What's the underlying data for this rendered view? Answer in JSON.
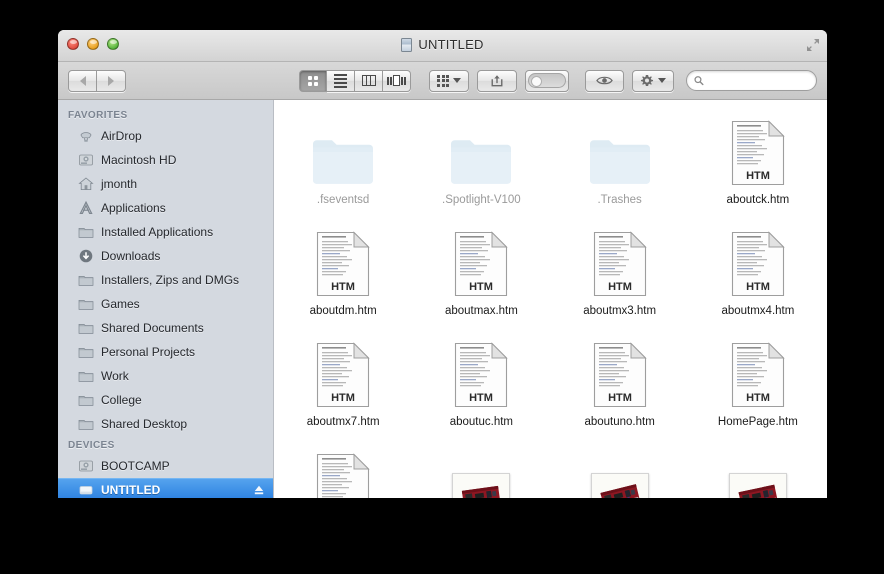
{
  "window": {
    "title": "UNTITLED",
    "title_icon": "drive-icon",
    "controls": {
      "close": "close-button",
      "minimize": "minimize-button",
      "zoom": "zoom-button",
      "fullscreen": "fullscreen-button"
    }
  },
  "toolbar": {
    "back_label": "Back",
    "forward_label": "Forward",
    "views": [
      {
        "name": "icon-view",
        "label": "Icon View",
        "active": true
      },
      {
        "name": "list-view",
        "label": "List View",
        "active": false
      },
      {
        "name": "column-view",
        "label": "Column View",
        "active": false
      },
      {
        "name": "coverflow-view",
        "label": "Cover Flow View",
        "active": false
      }
    ],
    "arrange_label": "Arrange",
    "share_label": "Share",
    "tags_label": "Edit Tags",
    "quicklook_label": "Quick Look",
    "action_label": "Action",
    "search": {
      "value": "",
      "placeholder": ""
    }
  },
  "sidebar": {
    "sections": [
      {
        "header": "FAVORITES",
        "items": [
          {
            "label": "AirDrop",
            "icon": "airdrop-icon",
            "selected": false
          },
          {
            "label": "Macintosh HD",
            "icon": "harddisk-icon",
            "selected": false
          },
          {
            "label": "jmonth",
            "icon": "home-icon",
            "selected": false
          },
          {
            "label": "Applications",
            "icon": "applications-icon",
            "selected": false
          },
          {
            "label": "Installed Applications",
            "icon": "folder-icon",
            "selected": false
          },
          {
            "label": "Downloads",
            "icon": "downloads-icon",
            "selected": false
          },
          {
            "label": "Installers, Zips and DMGs",
            "icon": "folder-icon",
            "selected": false
          },
          {
            "label": "Games",
            "icon": "folder-icon",
            "selected": false
          },
          {
            "label": "Shared Documents",
            "icon": "folder-icon",
            "selected": false
          },
          {
            "label": "Personal Projects",
            "icon": "folder-icon",
            "selected": false
          },
          {
            "label": "Work",
            "icon": "folder-icon",
            "selected": false
          },
          {
            "label": "College",
            "icon": "folder-icon",
            "selected": false
          },
          {
            "label": "Shared Desktop",
            "icon": "folder-icon",
            "selected": false
          }
        ]
      },
      {
        "header": "DEVICES",
        "items": [
          {
            "label": "BOOTCAMP",
            "icon": "harddisk-icon",
            "selected": false
          },
          {
            "label": "UNTITLED",
            "icon": "removable-disk-icon",
            "selected": true,
            "eject": true
          }
        ]
      }
    ]
  },
  "files": [
    {
      "label": ".fseventsd",
      "kind": "folder",
      "hidden": true
    },
    {
      "label": ".Spotlight-V100",
      "kind": "folder",
      "hidden": true
    },
    {
      "label": ".Trashes",
      "kind": "folder",
      "hidden": true
    },
    {
      "label": "aboutck.htm",
      "kind": "htm",
      "hidden": false
    },
    {
      "label": "aboutdm.htm",
      "kind": "htm",
      "hidden": false
    },
    {
      "label": "aboutmax.htm",
      "kind": "htm",
      "hidden": false
    },
    {
      "label": "aboutmx3.htm",
      "kind": "htm",
      "hidden": false
    },
    {
      "label": "aboutmx4.htm",
      "kind": "htm",
      "hidden": false
    },
    {
      "label": "aboutmx7.htm",
      "kind": "htm",
      "hidden": false
    },
    {
      "label": "aboutuc.htm",
      "kind": "htm",
      "hidden": false
    },
    {
      "label": "aboutuno.htm",
      "kind": "htm",
      "hidden": false
    },
    {
      "label": "HomePage.htm",
      "kind": "htm",
      "hidden": false
    },
    {
      "label": "",
      "kind": "htm",
      "hidden": false
    },
    {
      "label": "",
      "kind": "image",
      "hidden": false
    },
    {
      "label": "",
      "kind": "image",
      "hidden": false
    },
    {
      "label": "",
      "kind": "image",
      "hidden": false
    }
  ],
  "colors": {
    "selection_blue": "#2a7fe0",
    "sidebar_bg": "#d4d9e0",
    "folder_blue": "#bcd6e8",
    "hidden_label": "#9a9a9a",
    "desktop_bg": "#000000"
  }
}
